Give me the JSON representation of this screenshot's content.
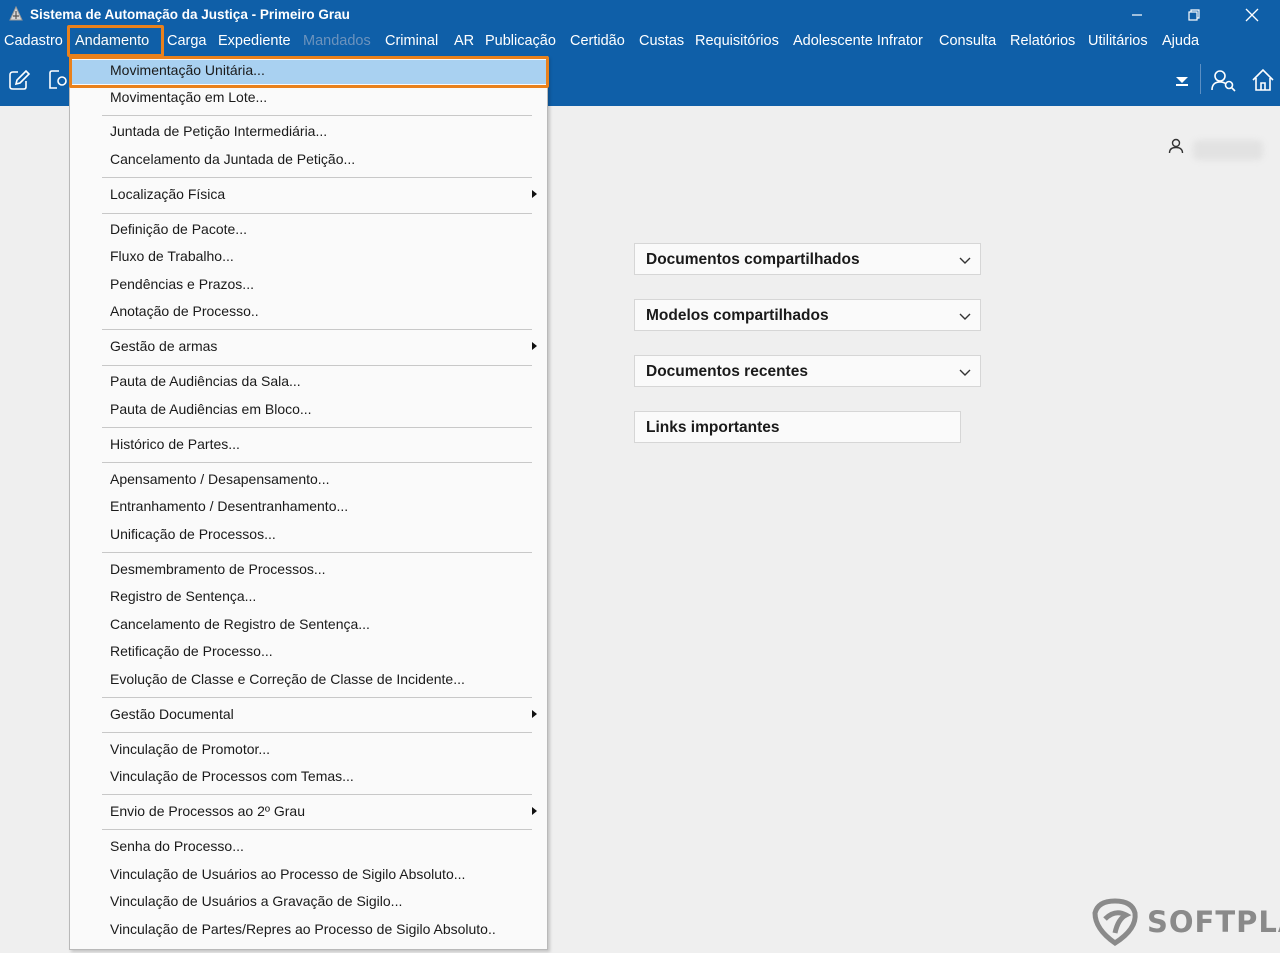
{
  "window": {
    "title": "Sistema de Automação da Justiça - Primeiro Grau",
    "app_icon": "justice-scale-icon",
    "minimize_icon": "minimize-icon",
    "restore_icon": "restore-icon",
    "close_icon": "close-icon"
  },
  "menubar": {
    "items": [
      {
        "label": "Cadastro"
      },
      {
        "label": "Andamento",
        "active": true
      },
      {
        "label": "Carga"
      },
      {
        "label": "Expediente"
      },
      {
        "label": "Mandados",
        "disabled": true
      },
      {
        "label": "Criminal"
      },
      {
        "label": "AR"
      },
      {
        "label": "Publicação"
      },
      {
        "label": "Certidão"
      },
      {
        "label": "Custas"
      },
      {
        "label": "Requisitórios"
      },
      {
        "label": "Adolescente Infrator"
      },
      {
        "label": "Consulta"
      },
      {
        "label": "Relatórios"
      },
      {
        "label": "Utilitários"
      },
      {
        "label": "Ajuda"
      }
    ]
  },
  "toolbar": {
    "icons": [
      "edit-document-icon",
      "search-document-icon",
      "filter-icon",
      "users-search-icon",
      "home-icon"
    ]
  },
  "dropdown": {
    "items": [
      {
        "label": "Movimentação Unitária...",
        "selected": true
      },
      {
        "label": "Movimentação em Lote..."
      },
      {
        "label": "Juntada de Petição Intermediária..."
      },
      {
        "label": "Cancelamento da Juntada de Petição..."
      },
      {
        "label": "Localização Física",
        "submenu": true
      },
      {
        "label": "Definição de Pacote..."
      },
      {
        "label": "Fluxo de Trabalho..."
      },
      {
        "label": "Pendências e Prazos..."
      },
      {
        "label": "Anotação de Processo.."
      },
      {
        "label": "Gestão de armas",
        "submenu": true
      },
      {
        "label": "Pauta de Audiências da Sala..."
      },
      {
        "label": "Pauta de Audiências em Bloco..."
      },
      {
        "label": "Histórico de Partes..."
      },
      {
        "label": "Apensamento / Desapensamento..."
      },
      {
        "label": "Entranhamento / Desentranhamento..."
      },
      {
        "label": "Unificação de Processos..."
      },
      {
        "label": "Desmembramento de Processos..."
      },
      {
        "label": "Registro de Sentença..."
      },
      {
        "label": "Cancelamento de Registro de Sentença..."
      },
      {
        "label": "Retificação de Processo..."
      },
      {
        "label": "Evolução de Classe e Correção de Classe de Incidente..."
      },
      {
        "label": "Gestão Documental",
        "submenu": true
      },
      {
        "label": "Vinculação de Promotor..."
      },
      {
        "label": "Vinculação de Processos com Temas..."
      },
      {
        "label": "Envio de Processos ao 2º Grau",
        "submenu": true
      },
      {
        "label": "Senha do Processo..."
      },
      {
        "label": "Vinculação de Usuários ao Processo de Sigilo Absoluto..."
      },
      {
        "label": "Vinculação de Usuários a Gravação de Sigilo..."
      },
      {
        "label": "Vinculação de Partes/Repres ao Processo de Sigilo Absoluto.."
      }
    ]
  },
  "panels": [
    {
      "title": "Documentos compartilhados",
      "icon": "chevron-down-icon"
    },
    {
      "title": "Modelos compartilhados",
      "icon": "chevron-down-icon"
    },
    {
      "title": "Documentos recentes",
      "icon": "chevron-down-icon"
    },
    {
      "title": "Links importantes"
    }
  ],
  "user": {
    "icon": "user-icon"
  },
  "logo": {
    "text": "SOFTPLAN",
    "icon": "softplan-logo-icon"
  },
  "colors": {
    "header_blue": "#0f5fa8",
    "highlight_orange": "#e9811c",
    "selection_blue": "#a9d1f1"
  }
}
